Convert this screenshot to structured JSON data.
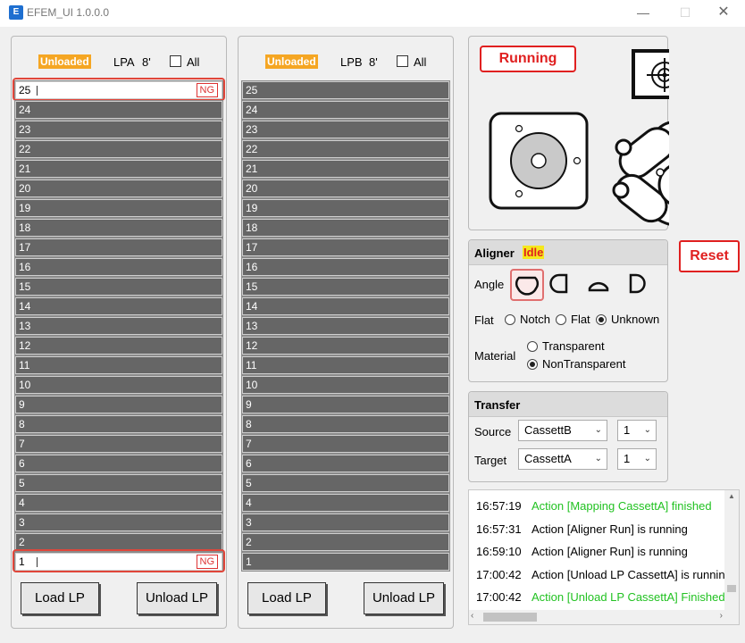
{
  "window": {
    "title": "EFEM_UI 1.0.0.0",
    "app_icon": "app-logo-icon",
    "minimize": "—",
    "maximize": "☐",
    "close": "✕"
  },
  "lpa": {
    "status": "Unloaded",
    "name": "LPA",
    "size": "8'",
    "all_label": "All",
    "slots": [
      {
        "num": "25",
        "state": "loaded",
        "result": "NG"
      },
      {
        "num": "24"
      },
      {
        "num": "23"
      },
      {
        "num": "22"
      },
      {
        "num": "21"
      },
      {
        "num": "20"
      },
      {
        "num": "19"
      },
      {
        "num": "18"
      },
      {
        "num": "17"
      },
      {
        "num": "16"
      },
      {
        "num": "15"
      },
      {
        "num": "14"
      },
      {
        "num": "13"
      },
      {
        "num": "12"
      },
      {
        "num": "11"
      },
      {
        "num": "10"
      },
      {
        "num": "9"
      },
      {
        "num": "8"
      },
      {
        "num": "7"
      },
      {
        "num": "6"
      },
      {
        "num": "5"
      },
      {
        "num": "4"
      },
      {
        "num": "3"
      },
      {
        "num": "2"
      },
      {
        "num": "1",
        "state": "loaded",
        "result": "NG"
      }
    ],
    "load_label": "Load LP",
    "unload_label": "Unload LP"
  },
  "lpb": {
    "status": "Unloaded",
    "name": "LPB",
    "size": "8'",
    "all_label": "All",
    "slots": [
      {
        "num": "25"
      },
      {
        "num": "24"
      },
      {
        "num": "23"
      },
      {
        "num": "22"
      },
      {
        "num": "21"
      },
      {
        "num": "20"
      },
      {
        "num": "19"
      },
      {
        "num": "18"
      },
      {
        "num": "17"
      },
      {
        "num": "16"
      },
      {
        "num": "15"
      },
      {
        "num": "14"
      },
      {
        "num": "13"
      },
      {
        "num": "12"
      },
      {
        "num": "11"
      },
      {
        "num": "10"
      },
      {
        "num": "9"
      },
      {
        "num": "8"
      },
      {
        "num": "7"
      },
      {
        "num": "6"
      },
      {
        "num": "5"
      },
      {
        "num": "4"
      },
      {
        "num": "3"
      },
      {
        "num": "2"
      },
      {
        "num": "1"
      }
    ],
    "load_label": "Load LP",
    "unload_label": "Unload LP"
  },
  "robot": {
    "status": "Running",
    "status_color": "#e02020"
  },
  "aligner": {
    "title": "Aligner",
    "status": "Idle",
    "angle_label": "Angle",
    "angle_options": [
      "notch-down-icon",
      "notch-left-icon",
      "notch-up-icon",
      "notch-right-icon"
    ],
    "angle_selected": 0,
    "flat_label": "Flat",
    "flat_options": [
      "Notch",
      "Flat",
      "Unknown"
    ],
    "flat_selected": "Unknown",
    "material_label": "Material",
    "material_options": [
      "Transparent",
      "NonTransparent"
    ],
    "material_selected": "NonTransparent"
  },
  "reset_label": "Reset",
  "transfer": {
    "title": "Transfer",
    "source_label": "Source",
    "source_cassette": "CassettB",
    "source_slot": "1",
    "target_label": "Target",
    "target_cassette": "CassettA",
    "target_slot": "1"
  },
  "log": [
    {
      "time": "16:57:19",
      "msg": "Action [Mapping CassettA] finished",
      "color": "green"
    },
    {
      "time": "16:57:31",
      "msg": "Action [Aligner Run] is running",
      "color": "black"
    },
    {
      "time": "16:59:10",
      "msg": "Action [Aligner Run] is running",
      "color": "black"
    },
    {
      "time": "17:00:42",
      "msg": "Action [Unload LP CassettA] is running",
      "color": "black"
    },
    {
      "time": "17:00:42",
      "msg": "Action [Unload LP CassettA] Finished",
      "color": "green"
    }
  ],
  "colors": {
    "accent_orange": "#f5a623",
    "alert_red": "#e02020",
    "success_green": "#22c222",
    "slot_empty": "#666666"
  }
}
